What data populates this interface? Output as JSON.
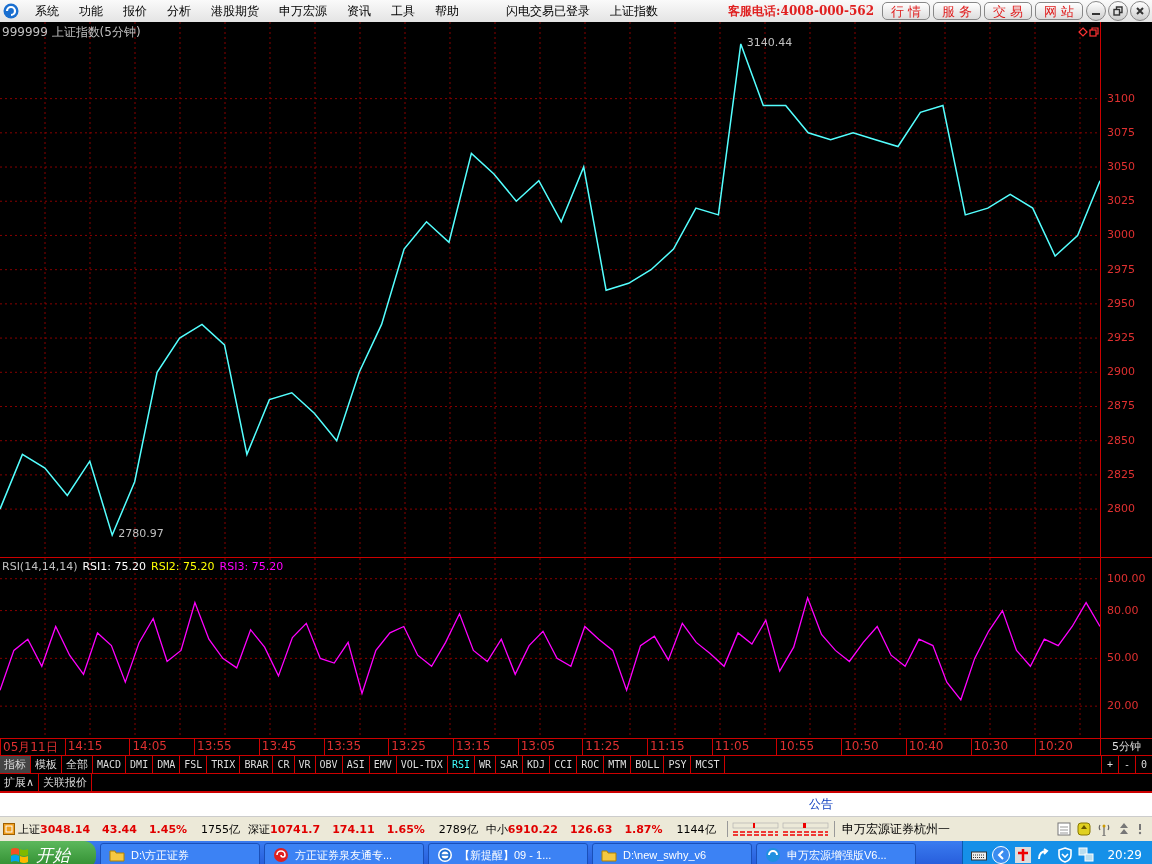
{
  "menu": {
    "items": [
      "系统",
      "功能",
      "报价",
      "分析",
      "港股期货",
      "申万宏源",
      "资讯",
      "工具",
      "帮助"
    ],
    "status": "闪电交易已登录",
    "index_link": "上证指数",
    "hotline": "客服电话:4008-000-562",
    "buttons": [
      "行 情",
      "服 务",
      "交 易",
      "网 站"
    ]
  },
  "main_chart": {
    "title": "999999 上证指数(5分钟)",
    "chart_data": {
      "type": "line",
      "grid": true,
      "ylim": [
        2765,
        3156
      ],
      "yticks": [
        2800,
        2825,
        2850,
        2875,
        2900,
        2925,
        2950,
        2975,
        3000,
        3025,
        3050,
        3075,
        3100
      ],
      "series": [
        {
          "color": "#54ffff",
          "values": [
            2800,
            2840,
            2830,
            2810,
            2835,
            2781,
            2820,
            2900,
            2925,
            2935,
            2920,
            2840,
            2880,
            2885,
            2870,
            2850,
            2900,
            2935,
            2990,
            3010,
            2995,
            3060,
            3045,
            3025,
            3040,
            3010,
            3050,
            2960,
            2965,
            2975,
            2990,
            3020,
            3015,
            3140,
            3095,
            3095,
            3075,
            3070,
            3075,
            3070,
            3065,
            3090,
            3095,
            3015,
            3020,
            3030,
            3020,
            2985,
            3000,
            3040
          ]
        }
      ]
    },
    "extreme_labels": [
      {
        "kind": "high",
        "label": "3140.44"
      },
      {
        "kind": "low",
        "label": "2780.97"
      }
    ]
  },
  "rsi_chart": {
    "title": "RSI(14,14,14)",
    "readings": [
      {
        "label": "RSI1: 75.20",
        "color": "#ffffff"
      },
      {
        "label": "RSI2: 75.20",
        "color": "#ffff00"
      },
      {
        "label": "RSI3: 75.20",
        "color": "#ff00ff"
      }
    ],
    "chart_data": {
      "type": "line",
      "grid": true,
      "ylim": [
        0,
        113
      ],
      "yticks": [
        {
          "value": 20,
          "label": "20.00"
        },
        {
          "value": 50,
          "label": "50.00"
        },
        {
          "value": 80,
          "label": "80.00"
        },
        {
          "value": 100,
          "label": "100.00"
        }
      ],
      "series": [
        {
          "color": "#ff00ff",
          "values": [
            30,
            55,
            62,
            45,
            70,
            52,
            40,
            66,
            58,
            35,
            60,
            75,
            48,
            55,
            85,
            62,
            50,
            44,
            68,
            57,
            39,
            63,
            72,
            50,
            47,
            60,
            28,
            55,
            66,
            70,
            52,
            45,
            60,
            78,
            55,
            48,
            62,
            40,
            58,
            67,
            50,
            45,
            70,
            62,
            55,
            30,
            58,
            64,
            49,
            72,
            60,
            53,
            45,
            66,
            59,
            74,
            42,
            57,
            88,
            65,
            55,
            48,
            60,
            70,
            52,
            45,
            62,
            58,
            35,
            24,
            50,
            67,
            80,
            55,
            45,
            62,
            58,
            70,
            85,
            70
          ]
        }
      ]
    }
  },
  "time_axis": [
    "05月11日",
    "14:15",
    "14:05",
    "13:55",
    "13:45",
    "13:35",
    "13:25",
    "13:15",
    "13:05",
    "11:25",
    "11:15",
    "11:05",
    "10:55",
    "10:50",
    "10:40",
    "10:30",
    "10:20"
  ],
  "period": "5分钟",
  "left_tabs": [
    {
      "label": "指标",
      "selected": true
    },
    {
      "label": "模板",
      "selected": false
    },
    {
      "label": "全部",
      "selected": false
    }
  ],
  "indicators": [
    {
      "label": "MACD",
      "selected": false
    },
    {
      "label": "DMI",
      "selected": false
    },
    {
      "label": "DMA",
      "selected": false
    },
    {
      "label": "FSL",
      "selected": false
    },
    {
      "label": "TRIX",
      "selected": false
    },
    {
      "label": "BRAR",
      "selected": false
    },
    {
      "label": "CR",
      "selected": false
    },
    {
      "label": "VR",
      "selected": false
    },
    {
      "label": "OBV",
      "selected": false
    },
    {
      "label": "ASI",
      "selected": false
    },
    {
      "label": "EMV",
      "selected": false
    },
    {
      "label": "VOL-TDX",
      "selected": false
    },
    {
      "label": "RSI",
      "selected": true
    },
    {
      "label": "WR",
      "selected": false
    },
    {
      "label": "SAR",
      "selected": false
    },
    {
      "label": "KDJ",
      "selected": false
    },
    {
      "label": "CCI",
      "selected": false
    },
    {
      "label": "ROC",
      "selected": false
    },
    {
      "label": "MTM",
      "selected": false
    },
    {
      "label": "BOLL",
      "selected": false
    },
    {
      "label": "PSY",
      "selected": false
    },
    {
      "label": "MCST",
      "selected": false
    }
  ],
  "zoom_buttons": [
    "+",
    "-",
    "0"
  ],
  "sub_tabs": [
    "扩展∧",
    "关联报价"
  ],
  "notice": "公告",
  "tickers": [
    {
      "name": "上证",
      "price": "3048.14",
      "change": "43.44",
      "percent": "1.45%",
      "volume": "1755亿"
    },
    {
      "name": "深证",
      "price": "10741.7",
      "change": "174.11",
      "percent": "1.65%",
      "volume": "2789亿"
    },
    {
      "name": "中小",
      "price": "6910.22",
      "change": "126.63",
      "percent": "1.87%",
      "volume": "1144亿"
    }
  ],
  "broker": "申万宏源证券杭州一",
  "taskbar": {
    "start": "开始",
    "tasks": [
      {
        "label": "D:\\方正证券",
        "kind": "folder"
      },
      {
        "label": "方正证券泉友通专...",
        "kind": "swirl"
      },
      {
        "label": "【新提醒】09 - 1...",
        "kind": "browser"
      },
      {
        "label": "D:\\new_swhy_v6",
        "kind": "folder"
      },
      {
        "label": "申万宏源增强版V6...",
        "kind": "app"
      }
    ],
    "time": "20:29"
  }
}
